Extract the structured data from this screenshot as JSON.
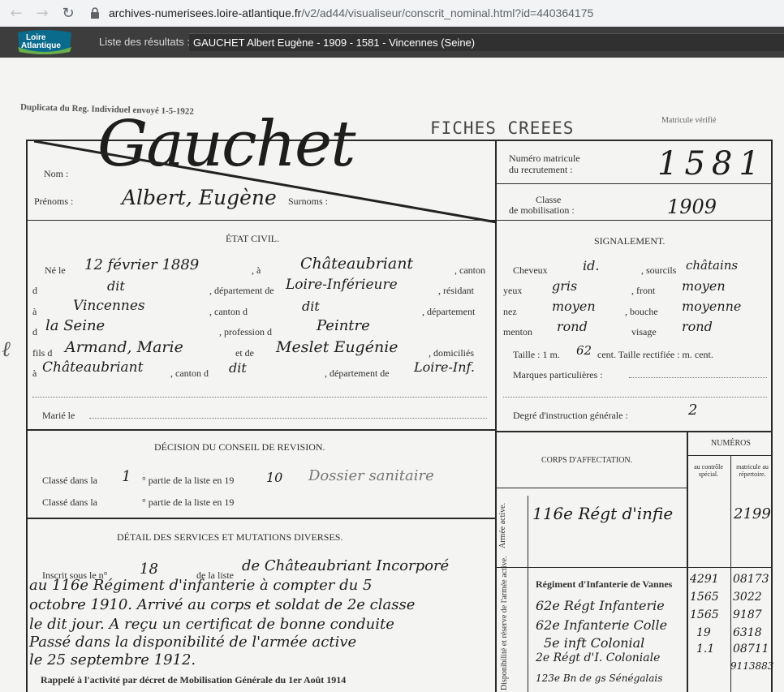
{
  "browser": {
    "back_icon": "arrow-left-icon",
    "forward_icon": "arrow-right-icon",
    "reload_icon": "reload-icon",
    "lock_icon": "lock-icon",
    "url_host": "archives-numerisees.loire-atlantique.fr",
    "url_path": "/v2/ad44/visualiseur/conscrit_nominal.html?id=440364175"
  },
  "header": {
    "logo_line1": "Loire",
    "logo_line2": "Atlantique",
    "results_label": "Liste des résultats :",
    "selected_result": "GAUCHET Albert Eugène - 1909 - 1581 - Vincennes (Seine)"
  },
  "document": {
    "duplicate_note": "Duplicata du Reg. Individuel envoyé  1-5-1922",
    "stamp": "FICHES CREEES",
    "verif": "Matricule vérifié",
    "nom_label": "Nom :",
    "nom_value": "Gauchet",
    "prenoms_label": "Prénoms :",
    "prenoms_value": "Albert, Eugène",
    "surnoms_label": "Surnoms :",
    "numero_label_1": "Numéro matricule",
    "numero_label_2": "du recrutement :",
    "numero_value": "1581",
    "classe_label_1": "Classe",
    "classe_label_2": "de mobilisation :",
    "classe_value": "1909",
    "etat_civil_title": "ÉTAT CIVIL.",
    "ne_le": "Né le",
    "birth_date": "12 février 1889",
    "a_label": ", à",
    "birth_place": "Châteaubriant",
    "canton_label": ", canton",
    "de_label": "d",
    "canton_value": "dit",
    "departement_label": ", département de",
    "departement_value": "Loire-Inférieure",
    "residant_label": ", résidant",
    "a2_label": "à",
    "residence": "Vincennes",
    "canton2_label": ", canton d",
    "canton2_value": "dit",
    "departement2_label": ", département",
    "de2_label": "d",
    "departement2_value": "la Seine",
    "profession_label": ", profession d",
    "profession_value": "Peintre",
    "fils_label": "fils d",
    "father": "Armand, Marie",
    "et_label": "et de",
    "mother": "Meslet Eugénie",
    "domicilies_label": ", domiciliés",
    "a3_label": "à",
    "domicile": "Châteaubriant",
    "canton3_label": ", canton d",
    "canton3_value": "dit",
    "departement3_label": ", département de",
    "departement3_value": "Loire-Inf.",
    "marie_label": "Marié le",
    "signalement_title": "SIGNALEMENT.",
    "cheveux_label": "Cheveux",
    "cheveux_value": "id.",
    "sourcils_label": ", sourcils",
    "sourcils_value": "châtains",
    "yeux_label": "yeux",
    "yeux_value": "gris",
    "front_label": ", front",
    "front_value": "moyen",
    "nez_label": "nez",
    "nez_value": "moyen",
    "bouche_label": ", bouche",
    "bouche_value": "moyenne",
    "menton_label": "menton",
    "menton_value": "rond",
    "visage_label": "visage",
    "visage_value": "rond",
    "taille_label": "Taille : 1 m.",
    "taille_value": "62",
    "taille_rest": "cent. Taille rectifiée :      m.     cent.",
    "marques_label": "Marques particulières :",
    "degre_label": "Degré d'instruction générale :",
    "degre_value": "2",
    "decision_title": "DÉCISION DU CONSEIL DE REVISION.",
    "classe_dans_1": "Classé dans la",
    "classe_dans_1_value": "1",
    "partie_1": "° partie de la liste en 19",
    "partie_1_year": "10",
    "dossier": "Dossier sanitaire",
    "classe_dans_2": "Classé dans la",
    "partie_2": "° partie de la liste en 19",
    "detail_title": "DÉTAIL DES SERVICES ET MUTATIONS DIVERSES.",
    "inscrit_label": "Inscrit sous le n°",
    "inscrit_value": "18",
    "de_la_liste": "de la liste",
    "service_lines": [
      "de Châteaubriant  Incorporé",
      "au 116e Régiment d'infanterie à compter du 5",
      "octobre 1910. Arrivé au corps et soldat de 2e classe",
      "le dit jour. A reçu un certificat de bonne conduite",
      "Passé dans la disponibilité de l'armée active",
      "le 25 septembre 1912."
    ],
    "rappele": "Rappelé à l'activité par décret de Mobilisation Générale du 1er Août 1914",
    "numeros_title": "NUMÉROS",
    "corps_title": "CORPS D'AFFECTATION.",
    "au_controle": "au contrôle spécial.",
    "matricule_rep": "matricule au répertoire.",
    "armee_active": "Armée active.",
    "disponibilite": "Disponibilité et réserve de l'armée active.",
    "corps_1": "116e Régt d'infie",
    "corps_1_num": "2199",
    "corps_2": "Régiment d'Infanterie de Vannes",
    "corps_3": "62e Régt Infanterie",
    "corps_4": "62e Infanterie Colle",
    "corps_5": "5e inft Colonial",
    "corps_6": "2e Régt d'I. Coloniale",
    "corps_7": "123e Bn de gs Sénégalais",
    "nums_a": [
      "4291",
      "1565",
      "1565",
      "19",
      "1.1"
    ],
    "nums_b": [
      "08173",
      "3022",
      "9187",
      "6318",
      "08711",
      "9113883"
    ]
  }
}
